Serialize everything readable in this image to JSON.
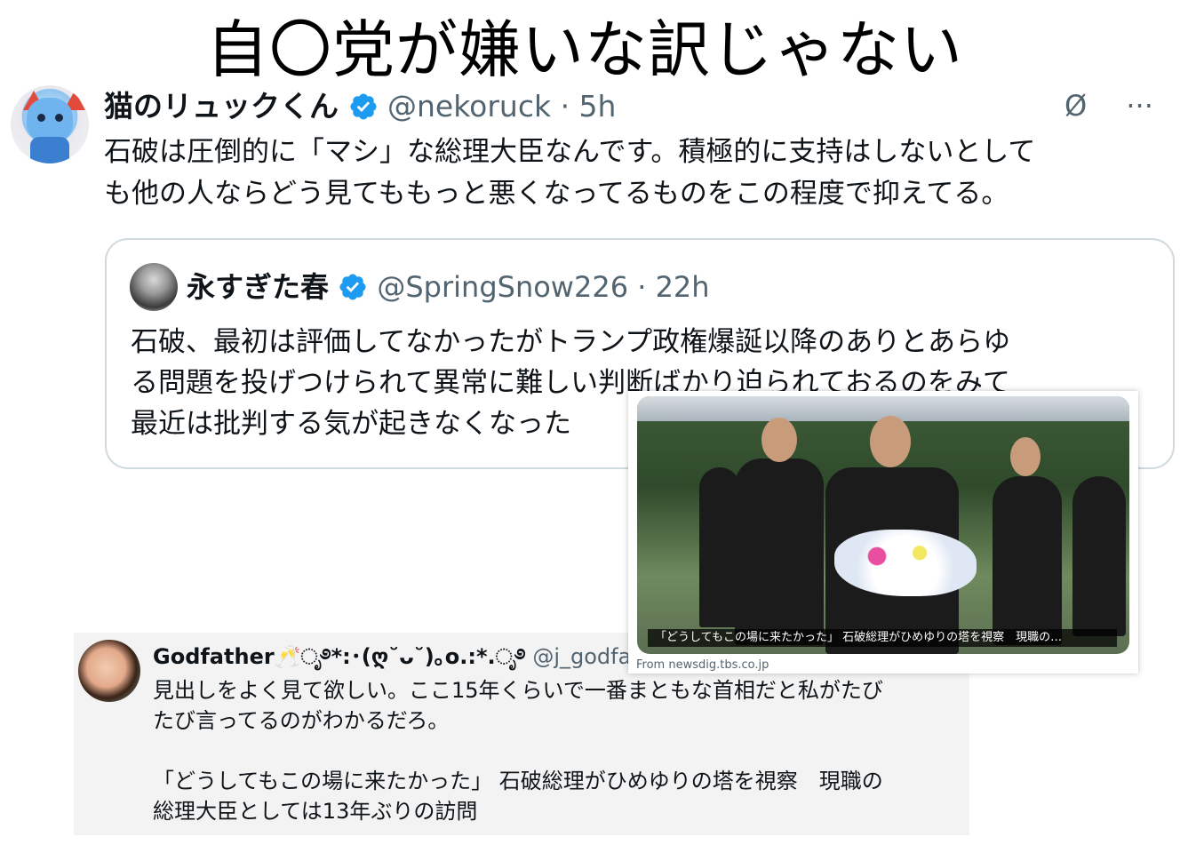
{
  "title": "自〇党が嫌いな訳じゃない",
  "main_tweet": {
    "name": "猫のリュックくん",
    "handle": "@nekoruck",
    "time": "· 5h",
    "grok_icon": "Ø",
    "more_icon": "···",
    "text_line1": "石破は圧倒的に「マシ」な総理大臣なんです。積極的に支持はしないとして",
    "text_line2": "も他の人ならどう見てももっと悪くなってるものをこの程度で抑えてる。"
  },
  "quoted_tweet": {
    "name": "永すぎた春",
    "handle": "@SpringSnow226",
    "time": "· 22h",
    "text_line1": "石破、最初は評価してなかったがトランプ政権爆誕以降のありとあらゆ",
    "text_line2": "る問題を投げつけられて異常に難しい判断ばかり迫られておるのをみて",
    "text_line3": "最近は批判する気が起きなくなった"
  },
  "link_card": {
    "caption": "「どうしてもこの場に来たかった」 石破総理がひめゆりの塔を視察　現職の…",
    "source": "From newsdig.tbs.co.jp"
  },
  "godfather_tweet": {
    "name": "Godfather🥂ೃ࿔*:･(ღ˘ᴗ˘)｡o.:*.ೃ࿔",
    "handle": "@j_godfat",
    "text_line1": "見出しをよく見て欲しい。ここ15年くらいで一番まともな首相だと私がたび",
    "text_line2": "たび言ってるのがわかるだろ。",
    "text_line3": "「どうしてもこの場に来たかった」 石破総理がひめゆりの塔を視察　現職の",
    "text_line4": "総理大臣としては13年ぶりの訪問"
  },
  "colors": {
    "verified": "#1d9bf0",
    "handle": "#536471",
    "border": "#cfd9de"
  }
}
